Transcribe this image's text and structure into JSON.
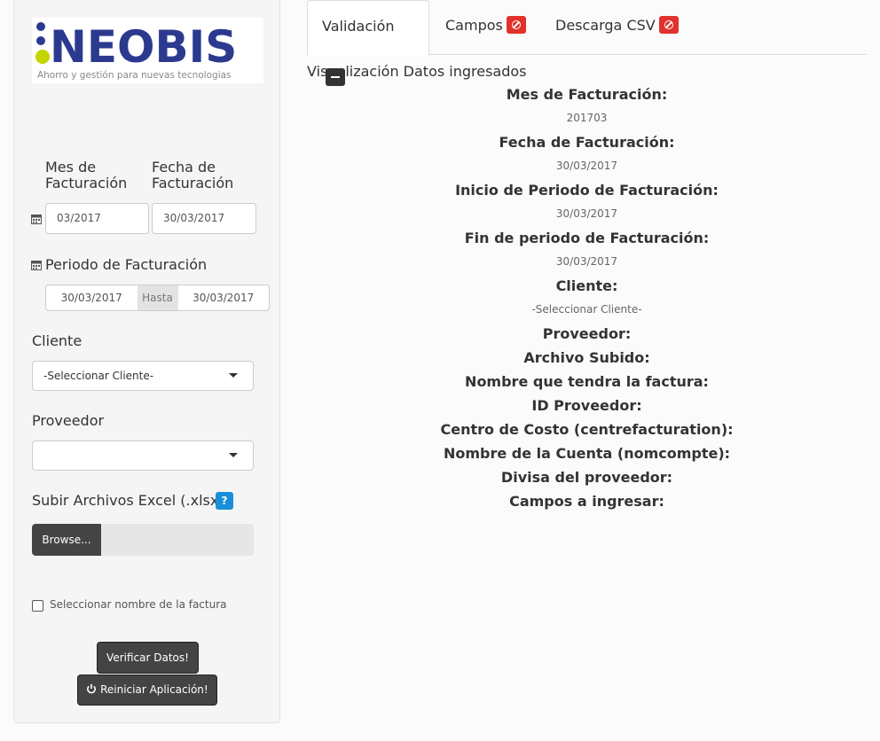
{
  "logo": {
    "name": "NEOBIS",
    "tagline": "Ahorro y gestión para nuevas tecnologias"
  },
  "form": {
    "mes_label": "Mes de Facturación",
    "mes_value": "03/2017",
    "fecha_label": "Fecha de Facturación",
    "fecha_value": "30/03/2017",
    "periodo_label": "Periodo de Facturación",
    "periodo_start": "30/03/2017",
    "periodo_sep": "Hasta",
    "periodo_end": "30/03/2017",
    "cliente_label": "Cliente",
    "cliente_value": "-Seleccionar Cliente-",
    "proveedor_label": "Proveedor",
    "proveedor_value": "",
    "upload_label": "Subir Archivos Excel (.xlsx)",
    "help_badge": "?",
    "browse_label": "Browse...",
    "checkbox_label": "Seleccionar nombre de la factura",
    "verify_button": "Verificar Datos!",
    "reset_button": "Reiniciar Aplicación!"
  },
  "tabs": [
    {
      "label": "Validación",
      "badge": "minus-icon"
    },
    {
      "label": "Campos",
      "badge": "ban-icon"
    },
    {
      "label": "Descarga CSV",
      "badge": "ban-icon"
    }
  ],
  "summary": {
    "title": "Visualización Datos ingresados",
    "mes_h": "Mes de Facturación:",
    "mes_v": "201703",
    "fecha_h": "Fecha de Facturación:",
    "fecha_v": "30/03/2017",
    "inicio_h": "Inicio de Periodo de Facturación:",
    "inicio_v": "30/03/2017",
    "fin_h": "Fin de periodo de Facturación:",
    "fin_v": "30/03/2017",
    "cliente_h": "Cliente:",
    "cliente_v": "-Seleccionar Cliente-",
    "proveedor_h": "Proveedor:",
    "archivo_h": "Archivo Subido:",
    "nombre_h": "Nombre que tendra la factura:",
    "id_h": "ID Proveedor:",
    "centro_h": "Centro de Costo (centrefacturation):",
    "cuenta_h": "Nombre de la Cuenta (nomcompte):",
    "divisa_h": "Divisa del proveedor:",
    "campos_h": "Campos a ingresar:"
  },
  "colors": {
    "accent_dark": "#444444",
    "danger": "#e0312b",
    "info": "#1a8fd9",
    "logo_blue": "#2b3a8f",
    "logo_green": "#c4d600"
  }
}
